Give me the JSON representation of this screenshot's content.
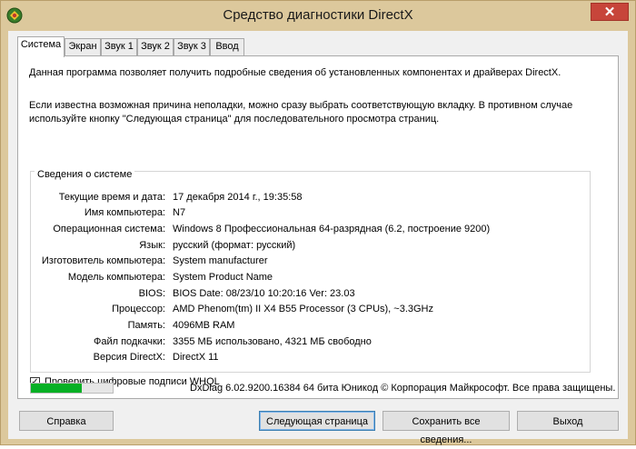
{
  "window": {
    "title": "Средство диагностики DirectX",
    "close_glyph": "✕"
  },
  "tabs": [
    {
      "label": "Система",
      "active": true
    },
    {
      "label": "Экран",
      "active": false
    },
    {
      "label": "Звук 1",
      "active": false
    },
    {
      "label": "Звук 2",
      "active": false
    },
    {
      "label": "Звук 3",
      "active": false
    },
    {
      "label": "Ввод",
      "active": false
    }
  ],
  "intro": {
    "line1": "Данная программа позволяет получить подробные сведения об установленных компонентах и драйверах DirectX.",
    "line2": "Если известна возможная причина неполадки, можно сразу выбрать соответствующую вкладку. В противном случае используйте кнопку \"Следующая страница\" для последовательного просмотра страниц."
  },
  "system_info": {
    "group_title": "Сведения о системе",
    "rows": [
      {
        "label": "Текущие время и дата:",
        "value": "17 декабря 2014 г., 19:35:58"
      },
      {
        "label": "Имя компьютера:",
        "value": "N7"
      },
      {
        "label": "Операционная система:",
        "value": "Windows 8 Профессиональная 64-разрядная (6.2, построение 9200)"
      },
      {
        "label": "Язык:",
        "value": "русский (формат: русский)"
      },
      {
        "label": "Изготовитель компьютера:",
        "value": "System manufacturer"
      },
      {
        "label": "Модель компьютера:",
        "value": "System Product Name"
      },
      {
        "label": "BIOS:",
        "value": "BIOS Date: 08/23/10 10:20:16 Ver: 23.03"
      },
      {
        "label": "Процессор:",
        "value": "AMD Phenom(tm) II X4 B55 Processor (3 CPUs), ~3.3GHz"
      },
      {
        "label": "Память:",
        "value": "4096MB RAM"
      },
      {
        "label": "Файл подкачки:",
        "value": "3355 МБ использовано, 4321 МБ свободно"
      },
      {
        "label": "Версия DirectX:",
        "value": "DirectX 11"
      }
    ]
  },
  "whql": {
    "label": "Проверить цифровые подписи WHQL",
    "checked": true,
    "check_glyph": "✓"
  },
  "progress": {
    "fraction": 0.62,
    "color": "#06b025"
  },
  "footer": {
    "copyright": "DxDiag 6.02.9200.16384 64 бита Юникод © Корпорация Майкрософт. Все права защищены."
  },
  "buttons": {
    "help": "Справка",
    "next_page": "Следующая страница",
    "save_all": "Сохранить все сведения...",
    "exit": "Выход"
  }
}
